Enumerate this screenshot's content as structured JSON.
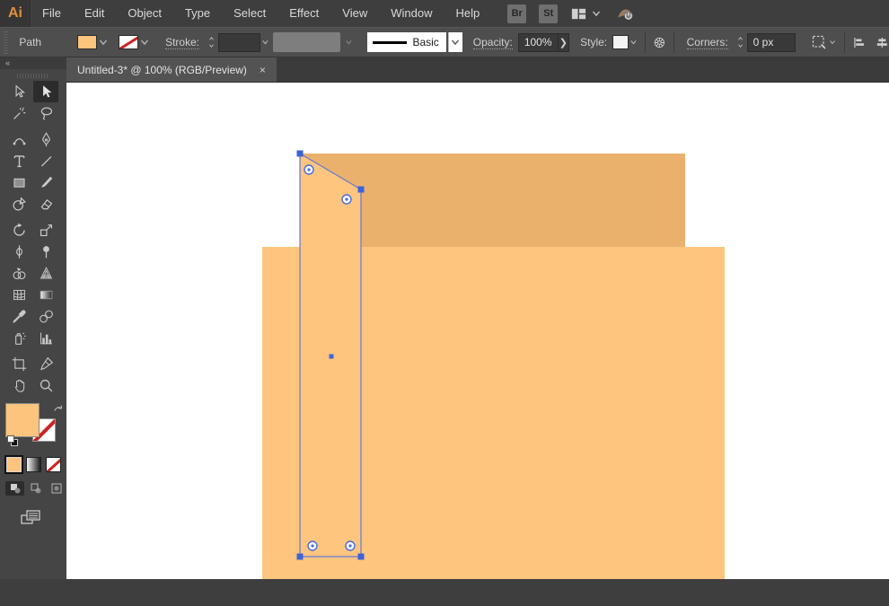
{
  "colors": {
    "logo_orange": "#e0913c",
    "back_rect": "#eab16c",
    "front_rect": "#fdc57e",
    "selected_path_fill": "#fdc57e",
    "selection_outline": "#6678d4",
    "selection_anchor": "#3d63d8",
    "widget_ring": "#4a6ade",
    "fill_swatch": "#fcc47c",
    "artboard": "#ffffff"
  },
  "menubar": {
    "logo": "Ai",
    "menus": [
      "File",
      "Edit",
      "Object",
      "Type",
      "Select",
      "Effect",
      "View",
      "Window",
      "Help"
    ],
    "bridge_button": "Br",
    "stock_button": "St"
  },
  "control_bar": {
    "selection_type": "Path",
    "stroke_label": "Stroke:",
    "stroke_style_value": "Basic",
    "opacity_label": "Opacity:",
    "opacity_value": "100%",
    "opacity_more": "❯",
    "style_label": "Style:",
    "corners_label": "Corners:",
    "corners_value": "0 px"
  },
  "tab_bar": {
    "active_tab_title": "Untitled-3* @ 100% (RGB/Preview)",
    "close_glyph": "×"
  },
  "toolbar": {
    "collapse_glyph": "«",
    "tools": [
      "direct-selection",
      "selection",
      "magic-wand",
      "lasso",
      "curvature",
      "pen",
      "type",
      "line-segment",
      "rectangle",
      "paintbrush",
      "shaper",
      "eraser",
      "rotate",
      "scale",
      "width",
      "puppet-warp",
      "shape-builder",
      "perspective-grid",
      "mesh",
      "gradient",
      "eyedropper",
      "blend",
      "symbol-sprayer",
      "column-graph",
      "artboard",
      "slice",
      "hand",
      "zoom"
    ],
    "active_tool": "selection"
  }
}
